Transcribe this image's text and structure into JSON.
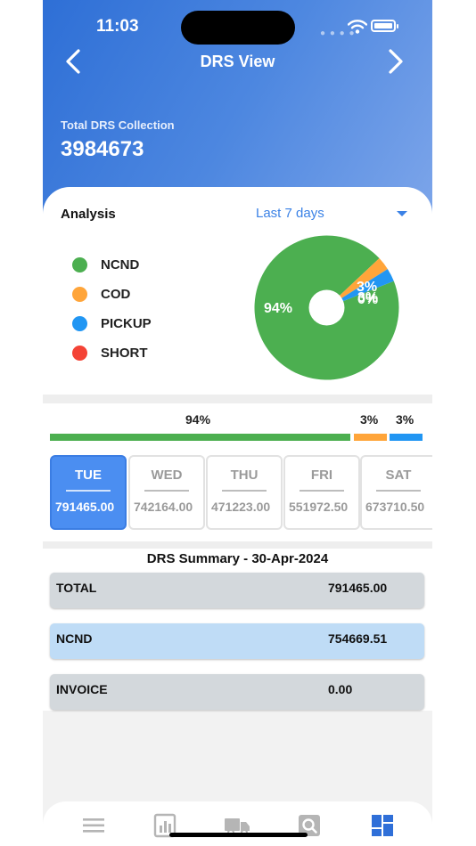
{
  "status_bar": {
    "time": "11:03"
  },
  "header": {
    "title": "DRS View",
    "total_label": "Total DRS Collection",
    "total_value": "3984673"
  },
  "analysis": {
    "label": "Analysis",
    "range_selected": "Last 7 days",
    "legend": [
      {
        "label": "NCND",
        "color": "#4caf50"
      },
      {
        "label": "COD",
        "color": "#ffa53a"
      },
      {
        "label": "PICKUP",
        "color": "#2196f3"
      },
      {
        "label": "SHORT",
        "color": "#f44336"
      }
    ]
  },
  "chart_data": {
    "type": "pie",
    "labels": [
      "NCND",
      "COD",
      "PICKUP",
      "SHORT"
    ],
    "values": [
      94,
      3,
      3,
      0
    ],
    "value_labels": [
      "94%",
      "3%",
      "3%",
      "0%"
    ],
    "colors": [
      "#4caf50",
      "#ffa53a",
      "#2196f3",
      "#f44336"
    ],
    "donut": true
  },
  "bar_breakdown": [
    {
      "label": "94%",
      "value": 94,
      "color": "#4caf50"
    },
    {
      "label": "3%",
      "value": 3,
      "color": "#ffa53a"
    },
    {
      "label": "3%",
      "value": 3,
      "color": "#2196f3"
    }
  ],
  "days": [
    {
      "name": "TUE",
      "value": "791465.00",
      "active": true
    },
    {
      "name": "WED",
      "value": "742164.00",
      "active": false
    },
    {
      "name": "THU",
      "value": "471223.00",
      "active": false
    },
    {
      "name": "FRI",
      "value": "551972.50",
      "active": false
    },
    {
      "name": "SAT",
      "value": "673710.50",
      "active": false
    }
  ],
  "summary": {
    "title": "DRS Summary - 30-Apr-2024",
    "rows": [
      {
        "label": "TOTAL",
        "value": "791465.00"
      },
      {
        "label": "NCND",
        "value": "754669.51"
      },
      {
        "label": "INVOICE",
        "value": "0.00"
      }
    ]
  },
  "tabbar": {
    "tabs": [
      {
        "icon": "menu-icon",
        "color": "#b5b5b5"
      },
      {
        "icon": "report-icon",
        "color": "#b5b5b5"
      },
      {
        "icon": "truck-icon",
        "color": "#b5b5b5"
      },
      {
        "icon": "search-icon",
        "color": "#b5b5b5"
      },
      {
        "icon": "dashboard-icon",
        "color": "#2f6fd8"
      }
    ]
  }
}
